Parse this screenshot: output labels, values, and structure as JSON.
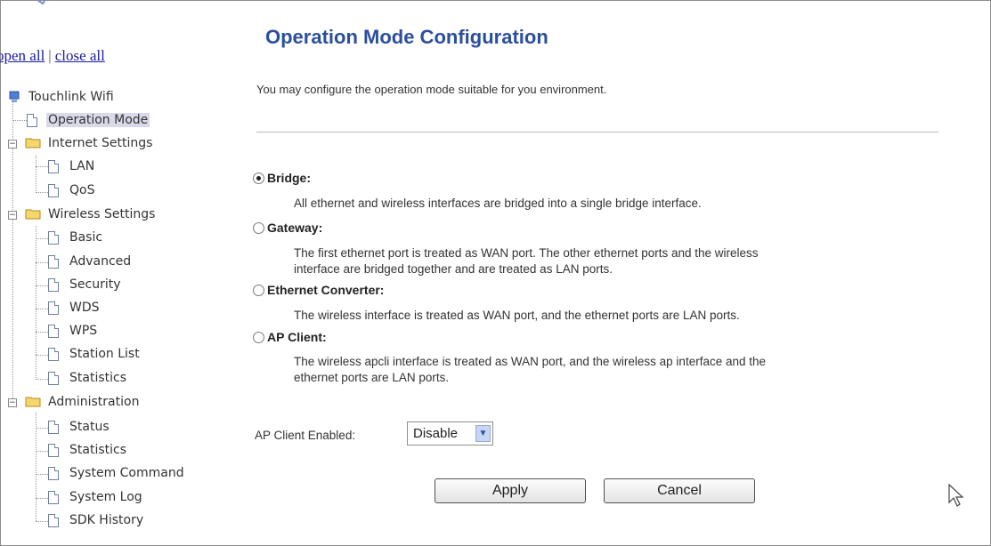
{
  "tree": {
    "open_all": "open all",
    "close_all": "close all",
    "separator": "|",
    "root": "Touchlink Wifi",
    "operation_mode": "Operation Mode",
    "internet_settings": {
      "label": "Internet Settings",
      "items": [
        "LAN",
        "QoS"
      ]
    },
    "wireless_settings": {
      "label": "Wireless Settings",
      "items": [
        "Basic",
        "Advanced",
        "Security",
        "WDS",
        "WPS",
        "Station List",
        "Statistics"
      ]
    },
    "administration": {
      "label": "Administration",
      "items": [
        "Status",
        "Statistics",
        "System Command",
        "System Log",
        "SDK History"
      ]
    }
  },
  "main": {
    "title": "Operation Mode Configuration",
    "description": "You may configure the operation mode suitable for you environment.",
    "options": [
      {
        "label": "Bridge:",
        "selected": true,
        "desc": [
          "All ethernet and wireless interfaces are bridged into a single bridge interface."
        ]
      },
      {
        "label": "Gateway:",
        "selected": false,
        "desc": [
          "The first ethernet port is treated as WAN port. The other ethernet ports and the wireless",
          "interface are bridged together and are treated as LAN ports."
        ]
      },
      {
        "label": "Ethernet Converter:",
        "selected": false,
        "desc": [
          "The wireless interface is treated as WAN port, and the ethernet ports are LAN ports."
        ]
      },
      {
        "label": "AP Client:",
        "selected": false,
        "desc": [
          "The wireless apcli interface is treated as WAN port, and the wireless ap interface and the",
          "ethernet ports are LAN ports."
        ]
      }
    ],
    "ap_client_label": "AP Client Enabled:",
    "ap_client_value": "Disable",
    "apply_label": "Apply",
    "cancel_label": "Cancel"
  },
  "colors": {
    "title": "#2b4f9e",
    "link": "#1a1a9c",
    "selected_node_bg": "#d9d9e9"
  }
}
